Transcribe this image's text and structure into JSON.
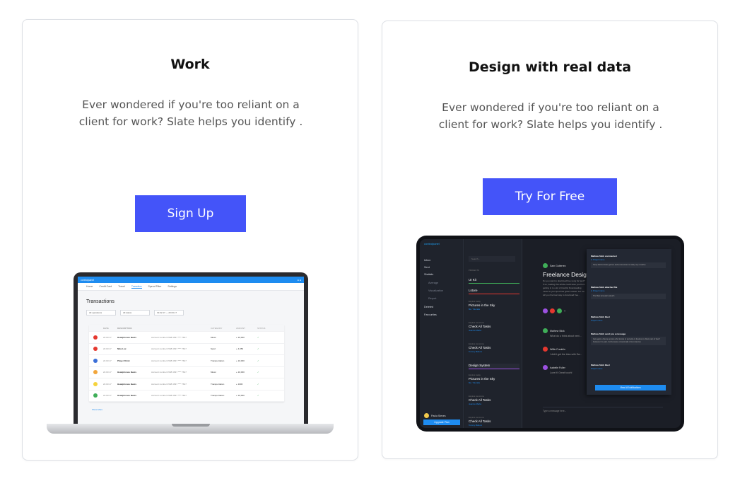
{
  "left_card": {
    "title": "Work",
    "description": "Ever wondered if you're too reliant on a client for work? Slate helps you identify .",
    "button_label": "Sign Up",
    "laptop": {
      "app_name": "controlpanel",
      "tabs": [
        "Home",
        "Credit Card",
        "Travel",
        "Transfers",
        "Spend Filter",
        "Settings"
      ],
      "title": "Transactions",
      "filters": [
        "All operations",
        "All status",
        "19.02.17 — 23.03.17"
      ],
      "columns": [
        "DATE",
        "DESCRIPTION",
        "",
        "CATEGORY",
        "AMOUNT",
        "STATUS"
      ],
      "rows": [
        {
          "date": "22.03.17",
          "name": "Headphones Beats",
          "account": "Account number 4548 4637 **** 7817",
          "category": "Music",
          "amount": "+ 10,000",
          "color": "#e5382f"
        },
        {
          "date": "22.03.17",
          "name": "Nike Lux",
          "account": "Account number 4548 4637 **** 7817",
          "category": "Sport",
          "amount": "+ 4,050",
          "color": "#e5382f"
        },
        {
          "date": "22.03.17",
          "name": "Player Drink",
          "account": "Account number 4548 4637 **** 7817",
          "category": "Transportation",
          "amount": "+ 10,000",
          "color": "#3b6fd8"
        },
        {
          "date": "22.03.17",
          "name": "Headphones Beats",
          "account": "Account number 4548 4637 **** 7817",
          "category": "Music",
          "amount": "+ 10,000",
          "color": "#f2a63b"
        },
        {
          "date": "22.03.17",
          "name": "Headphones Beats",
          "account": "Account number 4548 4637 **** 7817",
          "category": "Transportation",
          "amount": "+ 1000",
          "color": "#f5d33c"
        },
        {
          "date": "22.03.17",
          "name": "Headphones Beats",
          "account": "Account number 4548 4637 **** 7817",
          "category": "Transportation",
          "amount": "+ 10,000",
          "color": "#3fae58"
        }
      ],
      "more": "Show More"
    }
  },
  "right_card": {
    "title": "Design with real data",
    "description": "Ever wondered if you're too reliant on a client for work? Slate helps you identify .",
    "button_label": "Try For Free",
    "tablet": {
      "app_name": "controlpanel",
      "nav": [
        "Inbox",
        "Sent",
        "Statistic",
        "Average",
        "Visualization",
        "Report",
        "Deleted",
        "Favourites"
      ],
      "user": "Paula Steves",
      "upgrade": "Upgrade Plan",
      "search": "Search...",
      "projects": "PROJECTS",
      "sections": [
        "UI Kit",
        "Lstore",
        "Design System"
      ],
      "items": [
        {
          "meta": "Expires today",
          "title": "Pictures in the Sky",
          "sub": "Mo. Tutorials"
        },
        {
          "meta": "Expires tomorrow",
          "title": "Check All Tasks",
          "sub": "Jeannie Marks"
        },
        {
          "meta": "Expires tomorrow",
          "title": "Check All Tasks",
          "sub": "Tommy Mahoni"
        },
        {
          "meta": "Expires today",
          "title": "Pictures in the Sky",
          "sub": "Mo. Tutorials"
        },
        {
          "meta": "Expires tomorrow",
          "title": "Check All Tasks",
          "sub": "Jeannie Marks"
        },
        {
          "meta": "Expires tomorrow",
          "title": "Check All Tasks",
          "sub": "Tommy Mahoni"
        }
      ],
      "chat_author": "Sam Gutierrez",
      "heading": "Freelance Design",
      "body": "Do you want to download free song for ipod? If so, reading this article could save you from getting in to a lot of trouble! Downloading music to your Ipod has gotten easier. Let me tell you the best way to download free...",
      "chat": [
        {
          "name": "Mathew Stick",
          "text": "What do u think about next..."
        },
        {
          "name": "Willie Franklin",
          "text": "I didn't get the idea with Sw..."
        },
        {
          "name": "Isabelle Fuller",
          "text": "Love it! Great touch!"
        }
      ],
      "message_placeholder": "Type a message here...",
      "notifications": [
        {
          "title": "Mathew Stick commented",
          "link": "in Project name",
          "body": "Story behind video games and accessories is really very creative."
        },
        {
          "title": "Mathew Stick attached file",
          "link": "in Project name",
          "body": "The Best Acoustics sketch"
        },
        {
          "title": "Mathew Stick liked",
          "link": "Project name",
          "body": ""
        },
        {
          "title": "Mathew Stick send you a message",
          "link": "",
          "body": "Get again a theme anyone who knows or pursuits or desires to obtain pain of itself because it is pain, but because occasionally circumstances"
        },
        {
          "title": "Mathew Stick liked",
          "link": "Project name",
          "body": ""
        }
      ],
      "view_all": "View All Notifications"
    }
  }
}
